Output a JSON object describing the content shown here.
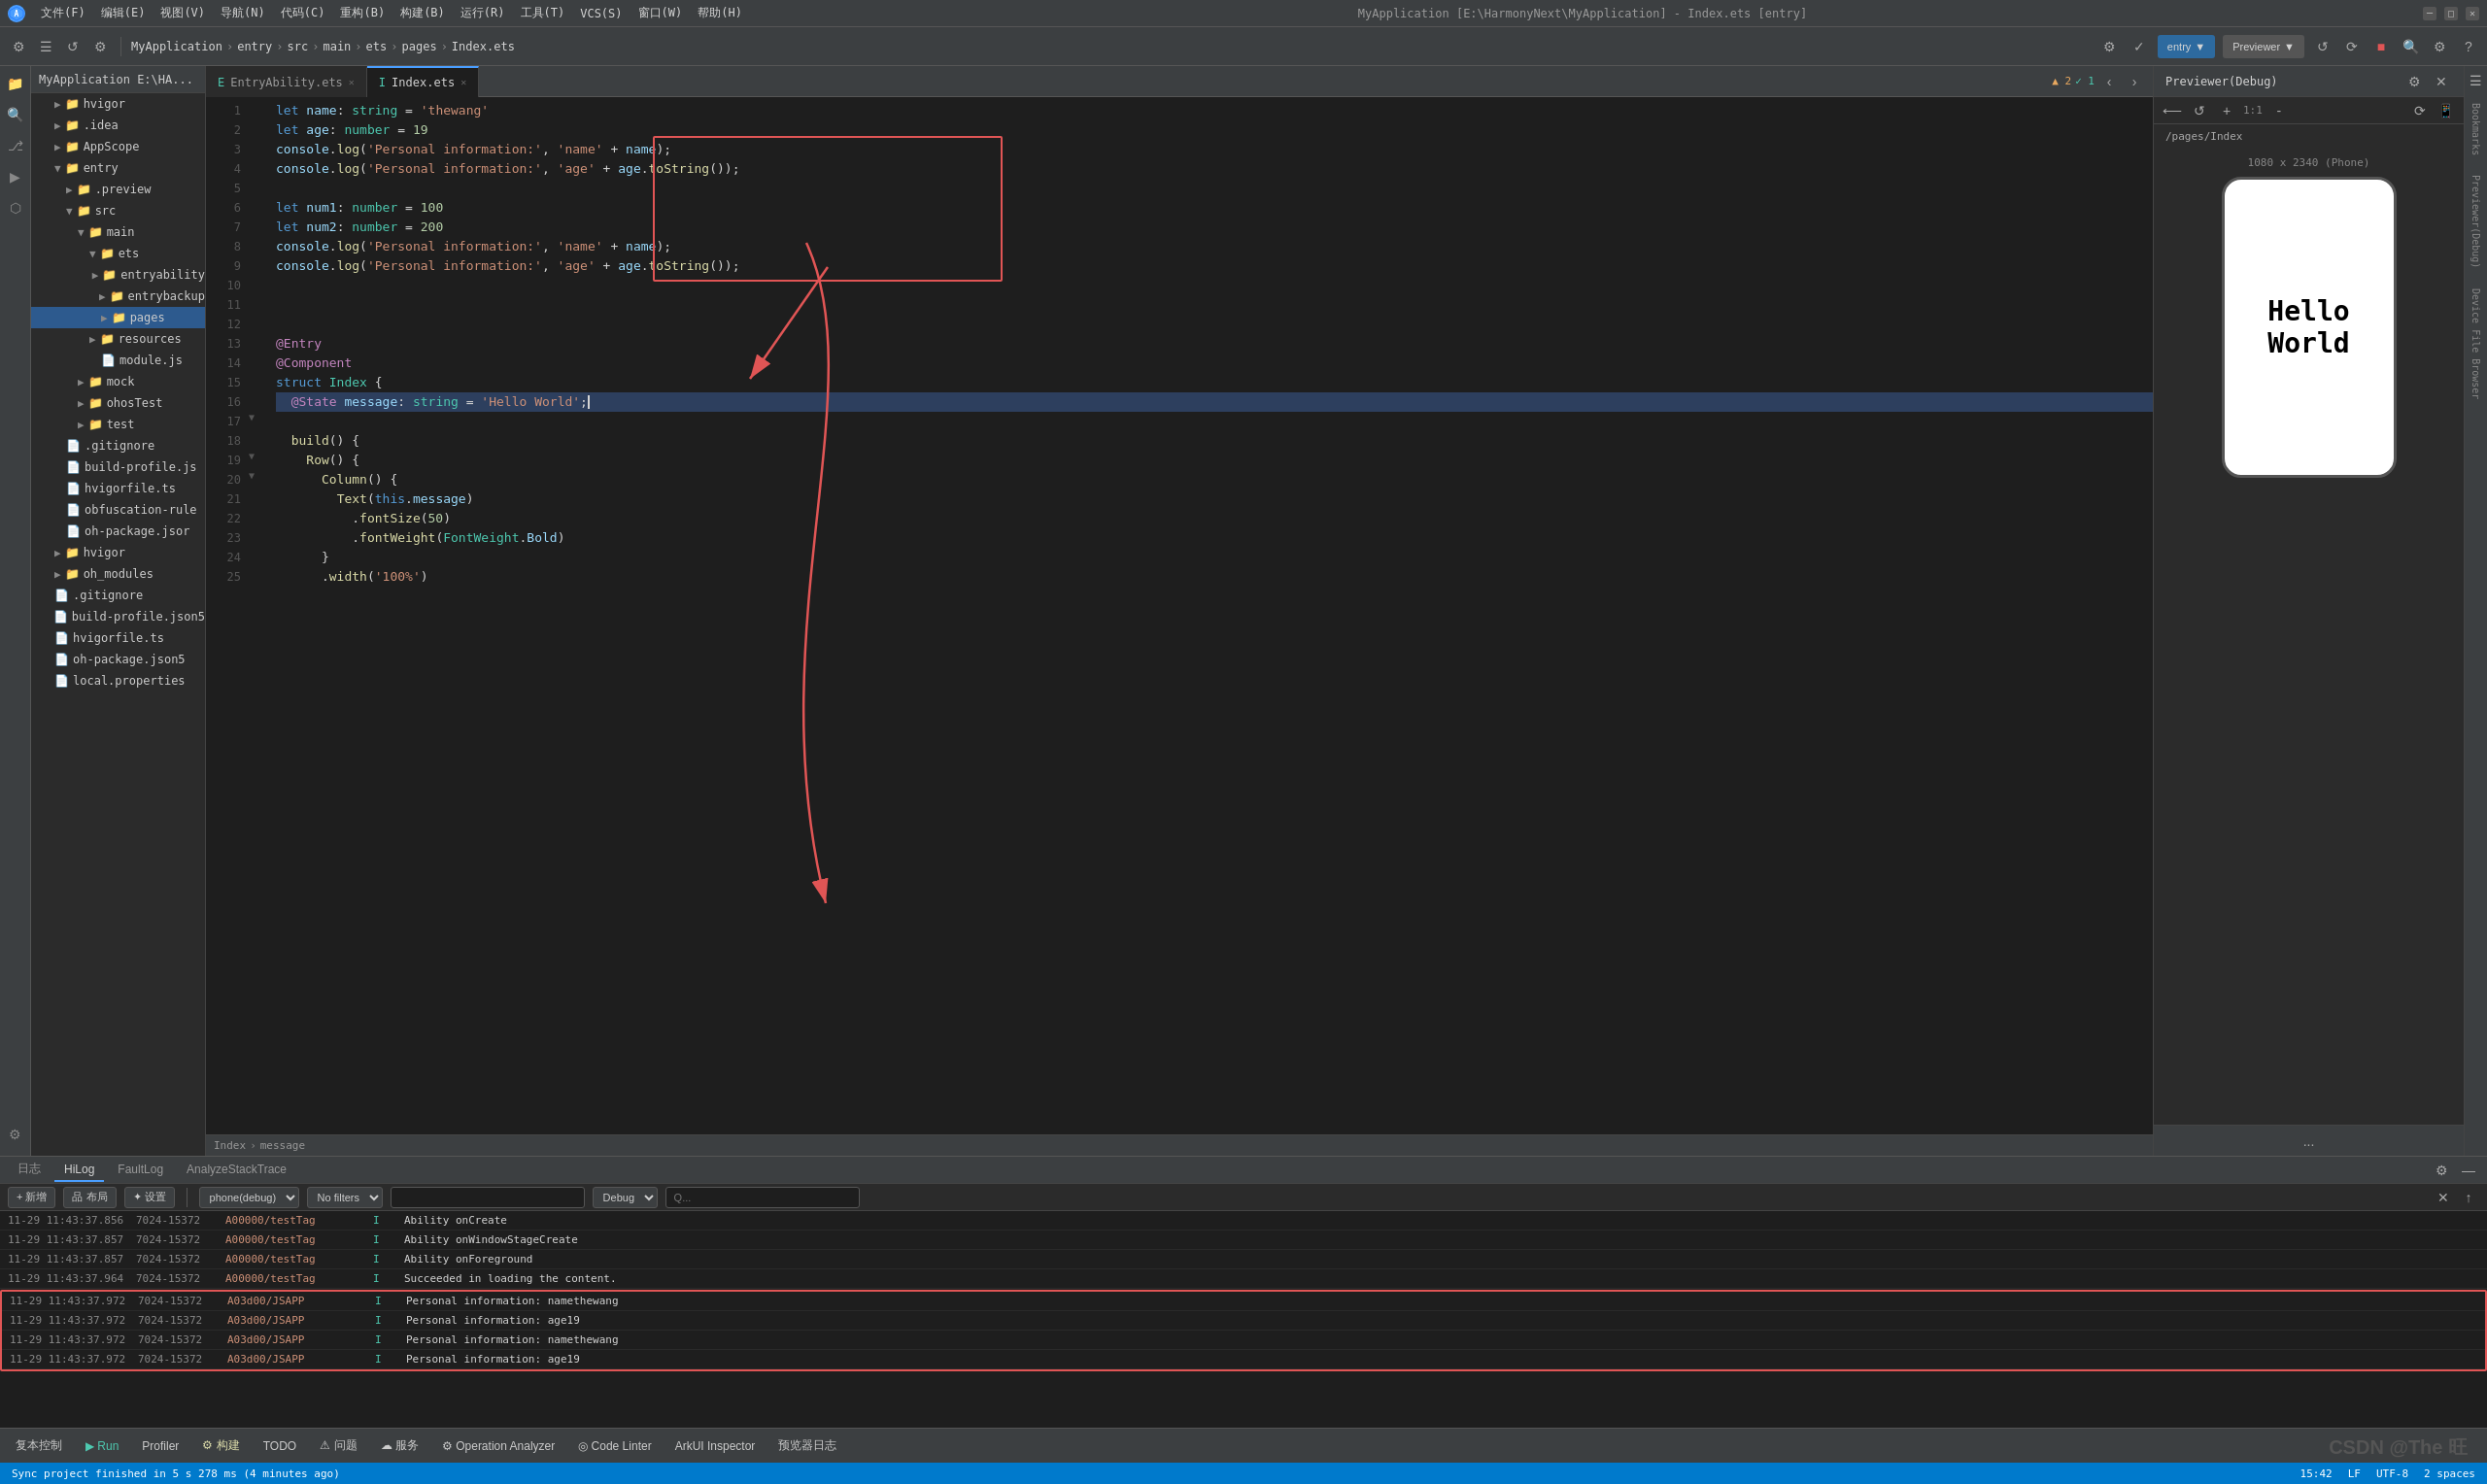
{
  "app": {
    "title": "MyApplication [E:\\HarmonyNext\\MyApplication] - Index.ets [entry]"
  },
  "menu": {
    "logo": "A",
    "items": [
      "文件(F)",
      "编辑(E)",
      "视图(V)",
      "导航(N)",
      "代码(C)",
      "重构(B)",
      "构建(B)",
      "运行(R)",
      "工具(T)",
      "VCS(S)",
      "窗口(W)",
      "帮助(H)"
    ]
  },
  "toolbar": {
    "breadcrumb": [
      "MyApplication",
      "entry",
      "src",
      "main",
      "ets",
      "pages",
      "Index.ets"
    ],
    "entry_btn": "entry",
    "previewer_btn": "Previewer"
  },
  "tabs": {
    "items": [
      {
        "label": "EntryAbility.ets",
        "active": false
      },
      {
        "label": "Index.ets",
        "active": true
      }
    ]
  },
  "code": {
    "lines": [
      {
        "num": 1,
        "content": "let name: string = 'thewang'"
      },
      {
        "num": 2,
        "content": "let age: number = 19"
      },
      {
        "num": 3,
        "content": "console.log('Personal information:', 'name' + name);"
      },
      {
        "num": 4,
        "content": "console.log('Personal information:', 'age' + age.toString());"
      },
      {
        "num": 5,
        "content": ""
      },
      {
        "num": 6,
        "content": "let num1: number = 100"
      },
      {
        "num": 7,
        "content": "let num2: number = 200"
      },
      {
        "num": 8,
        "content": "console.log('Personal information:', 'name' + name);"
      },
      {
        "num": 9,
        "content": "console.log('Personal information:', 'age' + age.toString());"
      },
      {
        "num": 10,
        "content": ""
      },
      {
        "num": 11,
        "content": ""
      },
      {
        "num": 12,
        "content": ""
      },
      {
        "num": 13,
        "content": "@Entry"
      },
      {
        "num": 14,
        "content": "@Component"
      },
      {
        "num": 15,
        "content": "struct Index {"
      },
      {
        "num": 16,
        "content": "  @State message: string = 'Hello World';"
      },
      {
        "num": 17,
        "content": ""
      },
      {
        "num": 18,
        "content": "  build() {"
      },
      {
        "num": 19,
        "content": "    Row() {"
      },
      {
        "num": 20,
        "content": "      Column() {"
      },
      {
        "num": 21,
        "content": "        Text(this.message)"
      },
      {
        "num": 22,
        "content": "          .fontSize(50)"
      },
      {
        "num": 23,
        "content": "          .fontWeight(FontWeight.Bold)"
      },
      {
        "num": 24,
        "content": "      }"
      },
      {
        "num": 25,
        "content": "      .width('100%')"
      }
    ]
  },
  "breadcrumb_bottom": {
    "items": [
      "Index",
      "message"
    ]
  },
  "previewer": {
    "title": "Previewer(Debug)",
    "path": "/pages/Index",
    "phone_label": "1080 x 2340 (Phone)",
    "hello_world": "Hello World",
    "more_btn": "..."
  },
  "bottom_tabs": {
    "items": [
      "日志",
      "HiLog",
      "FaultLog",
      "AnalyzeStackTrace"
    ]
  },
  "bottom_toolbar": {
    "add_btn": "+ 新增",
    "layout_btn": "品 布局",
    "settings_btn": "✦ 设置",
    "device_select": "phone(debug)",
    "filter_select": "No filters",
    "debug_select": "Debug",
    "search_placeholder": "Q..."
  },
  "logs": [
    {
      "time": "11-29 11:43:37.856",
      "pid": "7024-15372",
      "tag": "A00000/testTag",
      "level": "I",
      "msg": "Ability onCreate"
    },
    {
      "time": "11-29 11:43:37.857",
      "pid": "7024-15372",
      "tag": "A00000/testTag",
      "level": "I",
      "msg": "Ability onWindowStageCreate"
    },
    {
      "time": "11-29 11:43:37.857",
      "pid": "7024-15372",
      "tag": "A00000/testTag",
      "level": "I",
      "msg": "Ability onForeground"
    },
    {
      "time": "11-29 11:43:37.964",
      "pid": "7024-15372",
      "tag": "A00000/testTag",
      "level": "I",
      "msg": "Succeeded in loading the content."
    },
    {
      "time": "11-29 11:43:37.972",
      "pid": "7024-15372",
      "tag": "A03d00/JSAPP",
      "level": "I",
      "msg": "Personal information: namethewang"
    },
    {
      "time": "11-29 11:43:37.972",
      "pid": "7024-15372",
      "tag": "A03d00/JSAPP",
      "level": "I",
      "msg": "Personal information: age19"
    },
    {
      "time": "11-29 11:43:37.972",
      "pid": "7024-15372",
      "tag": "A03d00/JSAPP",
      "level": "I",
      "msg": "Personal information: namethewang"
    },
    {
      "time": "11-29 11:43:37.972",
      "pid": "7024-15372",
      "tag": "A03d00/JSAPP",
      "level": "I",
      "msg": "Personal information: age19"
    }
  ],
  "status_bar": {
    "sync_msg": "Sync project finished in 5 s 278 ms (4 minutes ago)",
    "time": "15:42",
    "lf": "LF",
    "encoding": "UTF-8",
    "spaces": "2 spaces",
    "watermark": "CSDN @The 旺"
  },
  "action_bar": {
    "copy_btn": "复本控制",
    "run_btn": "▶ Run",
    "profiler_btn": "Profiler",
    "build_btn": "⚙ 构建",
    "todo_btn": "TODO",
    "issues_btn": "⚠ 问题",
    "services_btn": "☁ 服务",
    "operation_btn": "⚙ Operation Analyzer",
    "code_linter_btn": "◎ Code Linter",
    "arkui_btn": "ArkUI Inspector",
    "preview_log_btn": "预览器日志"
  },
  "file_tree": {
    "root": "MyApplication E:\\HA...",
    "items": [
      {
        "label": "hvigor",
        "type": "folder",
        "level": 1,
        "icon": "▶"
      },
      {
        "label": ".idea",
        "type": "folder",
        "level": 1,
        "icon": "▶"
      },
      {
        "label": "AppScope",
        "type": "folder",
        "level": 1,
        "icon": "▶"
      },
      {
        "label": "entry",
        "type": "folder",
        "level": 1,
        "icon": "▼",
        "expanded": true
      },
      {
        "label": ".preview",
        "type": "folder",
        "level": 2,
        "icon": "▶"
      },
      {
        "label": "src",
        "type": "folder",
        "level": 2,
        "icon": "▼"
      },
      {
        "label": "main",
        "type": "folder",
        "level": 3,
        "icon": "▼"
      },
      {
        "label": "ets",
        "type": "folder",
        "level": 4,
        "icon": "▼"
      },
      {
        "label": "entryability",
        "type": "folder",
        "level": 5,
        "icon": "▶"
      },
      {
        "label": "entrybackup",
        "type": "folder",
        "level": 5,
        "icon": "▶"
      },
      {
        "label": "pages",
        "type": "folder",
        "level": 5,
        "icon": "▶"
      },
      {
        "label": "resources",
        "type": "folder",
        "level": 4,
        "icon": "▶"
      },
      {
        "label": "module.js",
        "type": "file",
        "level": 4,
        "icon": ""
      },
      {
        "label": "mock",
        "type": "folder",
        "level": 3,
        "icon": "▶"
      },
      {
        "label": "ohosTest",
        "type": "folder",
        "level": 3,
        "icon": "▶"
      },
      {
        "label": "test",
        "type": "folder",
        "level": 3,
        "icon": "▶"
      },
      {
        "label": ".gitignore",
        "type": "file",
        "level": 2,
        "icon": ""
      },
      {
        "label": "build-profile.js",
        "type": "file",
        "level": 2,
        "icon": ""
      },
      {
        "label": "hvigorfile.ts",
        "type": "file",
        "level": 2,
        "icon": ""
      },
      {
        "label": "obfuscation-rule",
        "type": "file",
        "level": 2,
        "icon": ""
      },
      {
        "label": "oh-package.jsor",
        "type": "file",
        "level": 2,
        "icon": ""
      },
      {
        "label": "hvigor",
        "type": "folder",
        "level": 1,
        "icon": "▶"
      },
      {
        "label": "oh_modules",
        "type": "folder",
        "level": 1,
        "icon": "▶"
      },
      {
        "label": ".gitignore",
        "type": "file",
        "level": 1,
        "icon": ""
      },
      {
        "label": "build-profile.json5",
        "type": "file",
        "level": 1,
        "icon": ""
      },
      {
        "label": "hvigorfile.ts",
        "type": "file",
        "level": 1,
        "icon": ""
      },
      {
        "label": "oh-package.json5",
        "type": "file",
        "level": 1,
        "icon": ""
      },
      {
        "label": "local.properties",
        "type": "file",
        "level": 1,
        "icon": ""
      }
    ]
  }
}
